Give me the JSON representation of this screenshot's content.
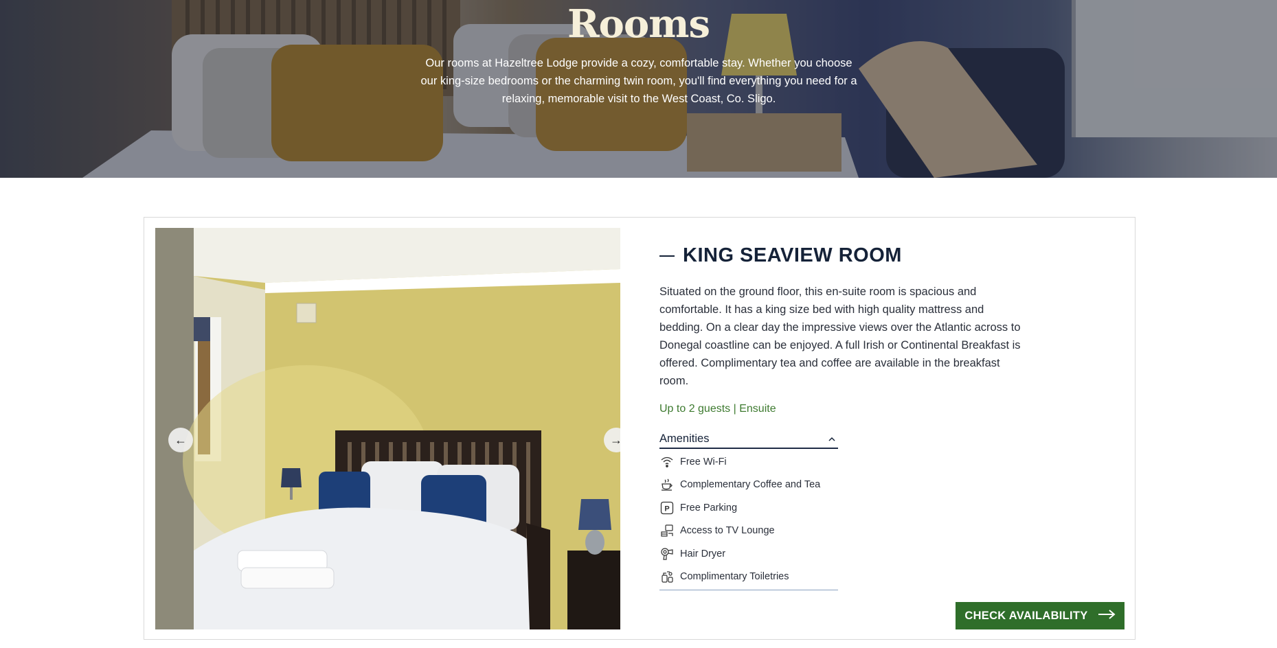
{
  "hero": {
    "title": "Rooms",
    "intro": "Our rooms at Hazeltree Lodge provide a cozy, comfortable stay. Whether you choose our king-size bedrooms or the charming twin room, you'll find everything you need for a relaxing, memorable visit to the West Coast, Co. Sligo."
  },
  "room": {
    "title": "KING SEAVIEW ROOM",
    "description": "Situated on the ground floor, this en-suite room is spacious and comfortable. It has a king size bed with high quality mattress and bedding. On a clear day the impressive views over the Atlantic across to Donegal coastline can be enjoyed. A full Irish or Continental Breakfast is offered. Complimentary tea and coffee are available in the breakfast room.",
    "meta": "Up to 2 guests | Ensuite",
    "amenities_label": "Amenities",
    "amenities": [
      {
        "label": "Free Wi-Fi",
        "icon": "wifi-icon"
      },
      {
        "label": "Complementary Coffee and Tea",
        "icon": "coffee-icon"
      },
      {
        "label": "Free Parking",
        "icon": "parking-icon"
      },
      {
        "label": "Access to TV Lounge",
        "icon": "tv-lounge-icon"
      },
      {
        "label": "Hair Dryer",
        "icon": "hair-dryer-icon"
      },
      {
        "label": "Complimentary Toiletries",
        "icon": "toiletries-icon"
      }
    ],
    "cta_label": "CHECK AVAILABILITY",
    "carousel": {
      "prev_icon": "←",
      "next_icon": "→"
    }
  },
  "colors": {
    "accent_green": "#2f6e2a",
    "meta_green": "#3d7a2f",
    "navy": "#152238",
    "hero_title": "#f6efd9"
  }
}
